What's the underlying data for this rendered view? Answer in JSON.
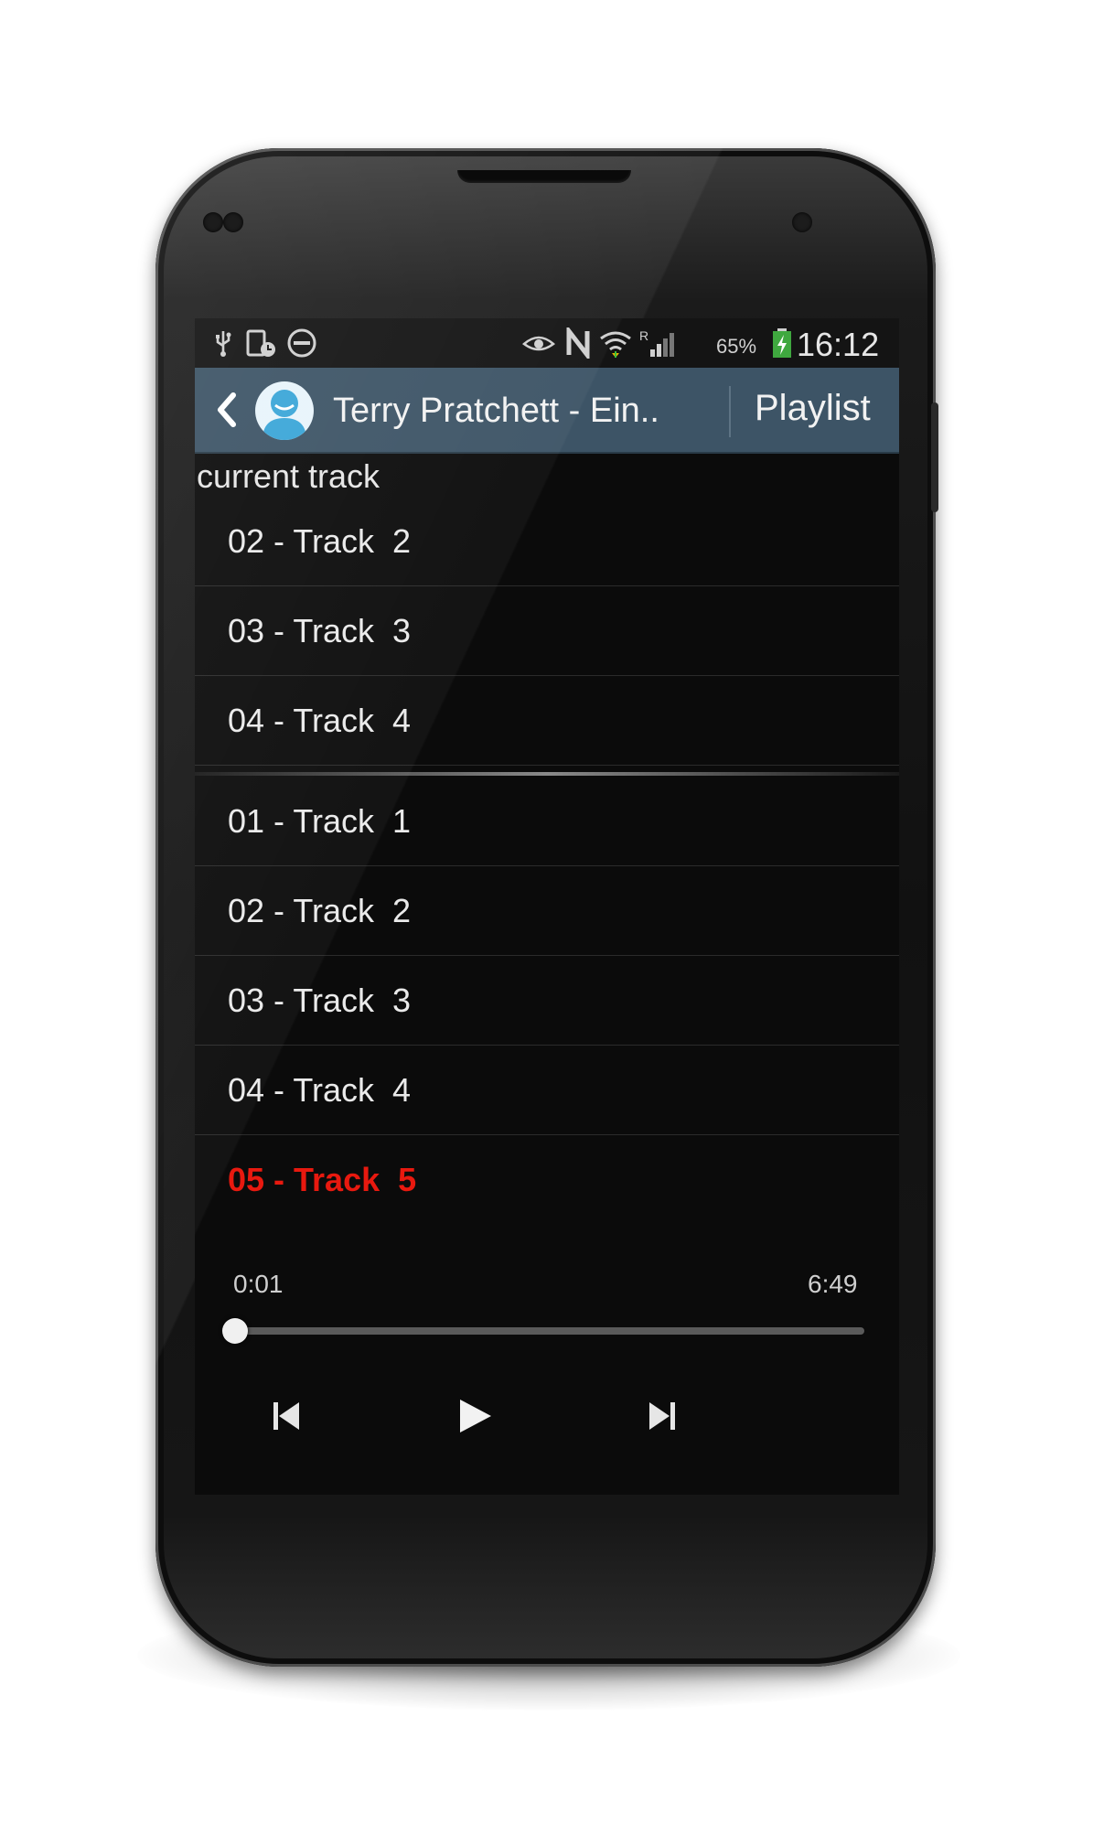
{
  "status_bar": {
    "icons": [
      "usb-icon",
      "phone-status-icon",
      "do-not-disturb-icon",
      "eye-icon",
      "nfc-icon",
      "wifi-icon",
      "signal-icon",
      "battery-charging-icon"
    ],
    "battery": "65%",
    "time": "16:12"
  },
  "action_bar": {
    "title": "Terry Pratchett - Ein..",
    "playlist_label": "Playlist",
    "accent_color": "#3d5466"
  },
  "section_label": "current track",
  "tracks_upper": [
    {
      "label": "02 - Track  2"
    },
    {
      "label": "03 - Track  3"
    },
    {
      "label": "04 - Track  4"
    }
  ],
  "tracks_lower": [
    {
      "label": "01 - Track  1"
    },
    {
      "label": "02 - Track  2"
    },
    {
      "label": "03 - Track  3"
    },
    {
      "label": "04 - Track  4"
    },
    {
      "label": "05 - Track  5",
      "active": true
    }
  ],
  "player": {
    "current_time": "0:01",
    "total_time": "6:49",
    "progress_fraction": 0.0025,
    "controls": [
      "skip-previous-icon",
      "play-icon",
      "skip-next-icon"
    ],
    "active_color": "#e8190f"
  }
}
